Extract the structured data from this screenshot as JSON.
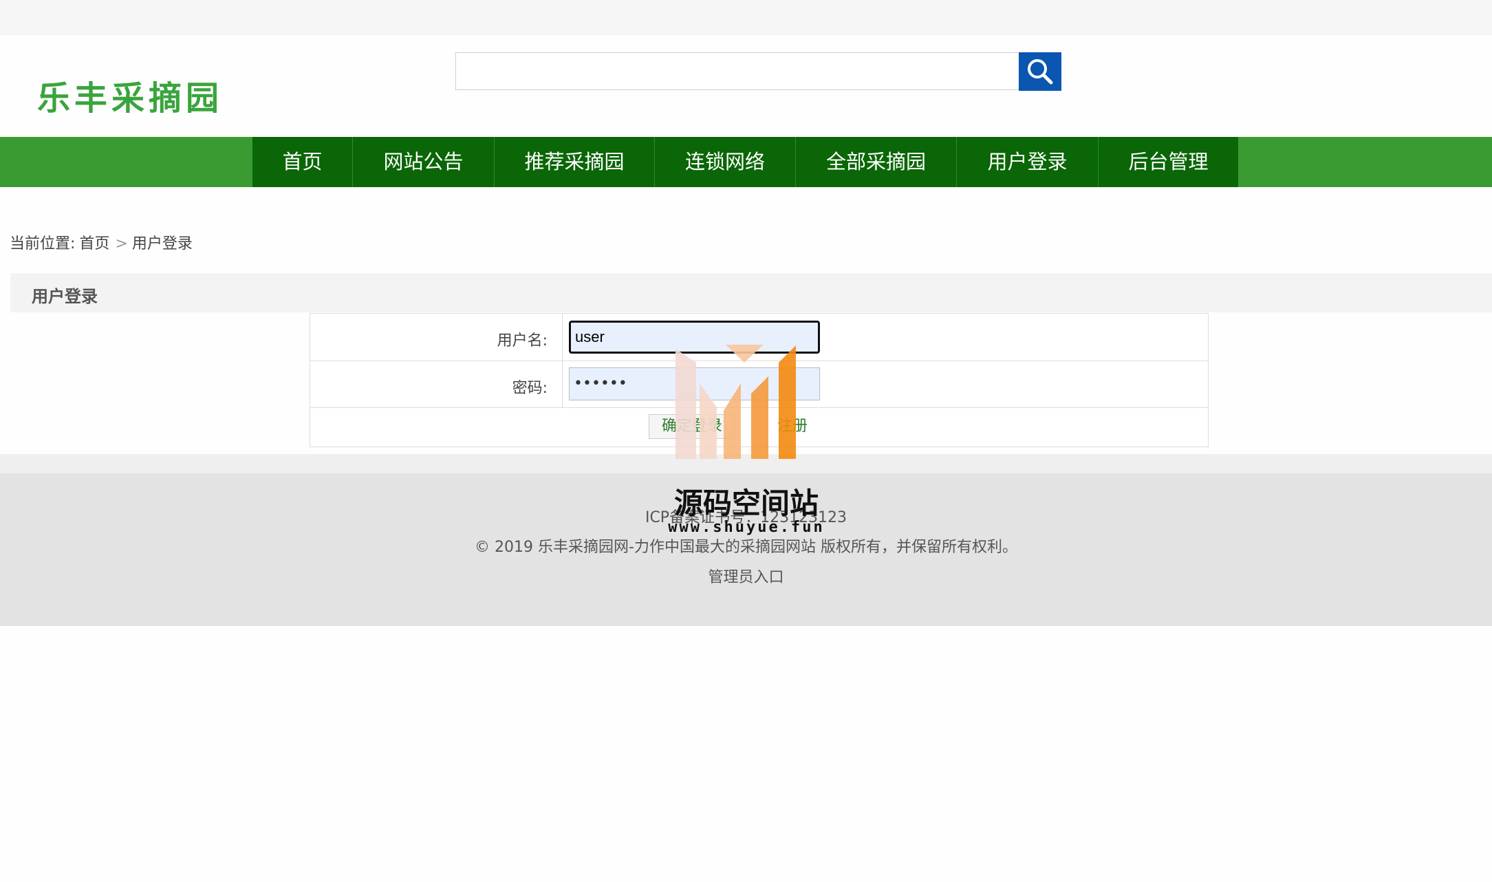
{
  "header": {
    "logo_text": "乐丰采摘园",
    "search_placeholder": "",
    "search_value": ""
  },
  "nav": {
    "items": [
      {
        "label": "首页"
      },
      {
        "label": "网站公告"
      },
      {
        "label": "推荐采摘园"
      },
      {
        "label": "连锁网络"
      },
      {
        "label": "全部采摘园"
      },
      {
        "label": "用户登录"
      },
      {
        "label": "后台管理"
      }
    ]
  },
  "breadcrumb": {
    "prefix": "当前位置:",
    "home": "首页",
    "separator": ">",
    "current": "用户登录"
  },
  "section": {
    "title": "用户登录"
  },
  "form": {
    "username_label": "用户名:",
    "username_value": "user",
    "password_label": "密码:",
    "password_value": "••••••",
    "login_button": "确定登录",
    "register_button": "注册"
  },
  "footer": {
    "icp": "ICP备案证书号：123123123",
    "copyright": "© 2019 乐丰采摘园网-力作中国最大的采摘园网站 版权所有，并保留所有权利。",
    "admin_link": "管理员入口"
  },
  "watermark": {
    "title": "源码空间站",
    "url": "www.shuyue.fun"
  },
  "colors": {
    "nav_dark": "#0a6606",
    "nav_light": "#3a9b32",
    "search_button": "#0a56b1",
    "logo": "#3aa43c"
  }
}
